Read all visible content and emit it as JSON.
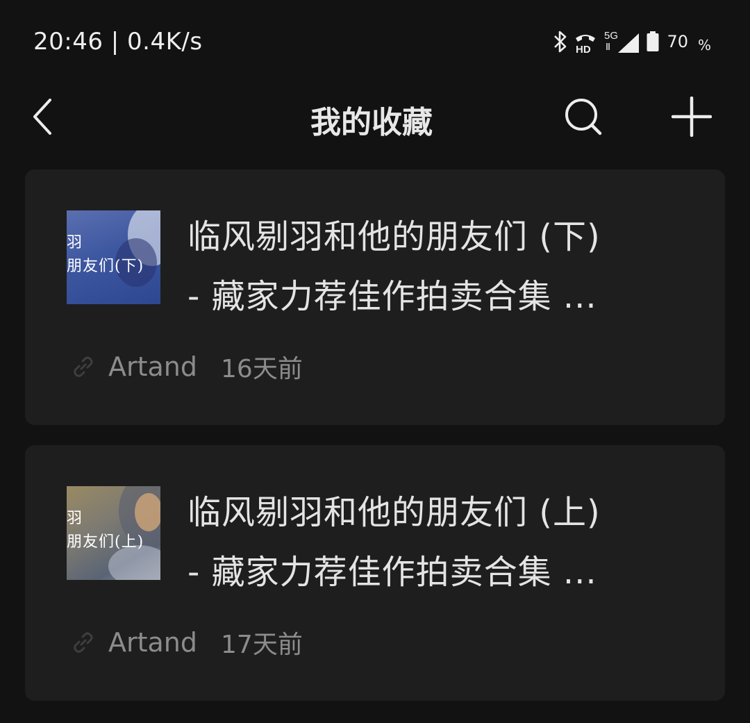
{
  "status_bar": {
    "time": "20:46 | 0.4K/s",
    "network": "5G",
    "hd": "HD",
    "battery_level": "70",
    "battery_unit": "%",
    "icons": [
      "bluetooth-icon",
      "hd-call-icon",
      "signal-icon",
      "battery-icon"
    ]
  },
  "nav": {
    "title": "我的收藏",
    "back_icon": "chevron-left-icon",
    "search_icon": "search-icon",
    "add_icon": "plus-icon"
  },
  "items": [
    {
      "title_line1": "临风剔羽和他的朋友们 (下)",
      "title_line2": "- 藏家力荐佳作拍卖合集 ...",
      "source": "Artand",
      "time": "16天前",
      "thumb_text_line1": "羽",
      "thumb_text_line2": "朋友们(下)",
      "thumb_color": "#3d57a0"
    },
    {
      "title_line1": "临风剔羽和他的朋友们 (上)",
      "title_line2": "- 藏家力荐佳作拍卖合集 ...",
      "source": "Artand",
      "time": "17天前",
      "thumb_text_line1": "羽",
      "thumb_text_line2": "朋友们(上)",
      "thumb_color": "#7d7a72"
    }
  ]
}
